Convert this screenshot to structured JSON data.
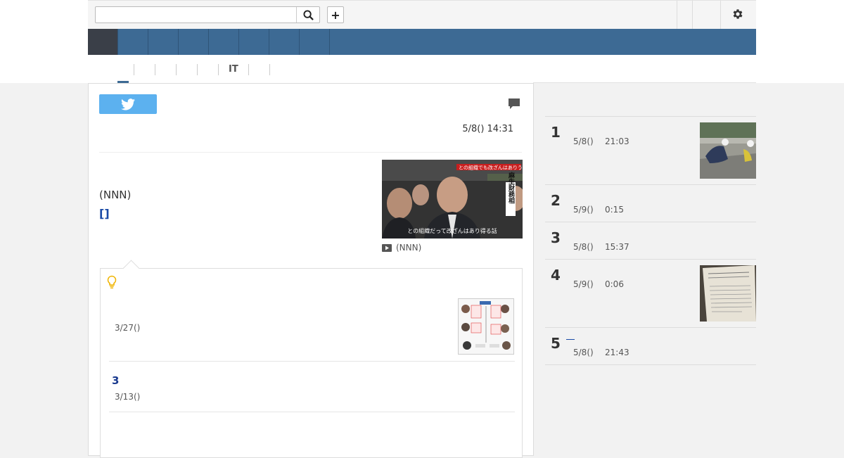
{
  "header": {
    "search": {
      "placeholder": "",
      "value": ""
    },
    "add_label": "+"
  },
  "nav": {
    "items": [
      "",
      "",
      "",
      "",
      "",
      "",
      "",
      "",
      ""
    ]
  },
  "subnav": {
    "items": [
      "",
      "",
      "",
      "",
      "",
      "IT",
      "",
      ""
    ]
  },
  "article": {
    "date": "5/8() 14:31",
    "source": "(NNN)",
    "link_text": "[]",
    "video_caption": "(NNN)",
    "thumbnail_caption": "との組織だって改ざんはあり得る話",
    "thumbnail_label": "麻生財務相",
    "thumbnail_banner": "との組織でも改ざんはありうる"
  },
  "related": {
    "items": [
      {
        "date": "3/27()"
      },
      {
        "title": "3",
        "date": "3/13()"
      }
    ]
  },
  "ranking": {
    "items": [
      {
        "rank": "1",
        "date": "5/8()",
        "time": "21:03"
      },
      {
        "rank": "2",
        "date": "5/9()",
        "time": "0:15"
      },
      {
        "rank": "3",
        "date": "5/8()",
        "time": "15:37"
      },
      {
        "rank": "4",
        "date": "5/9()",
        "time": "0:06"
      },
      {
        "rank": "5",
        "date": "5/8()",
        "time": "21:43"
      }
    ]
  },
  "colors": {
    "nav": "#3d6a94",
    "nav_active": "#3a3f48",
    "twitter": "#5cb1ef",
    "link": "#1a4aa6"
  }
}
